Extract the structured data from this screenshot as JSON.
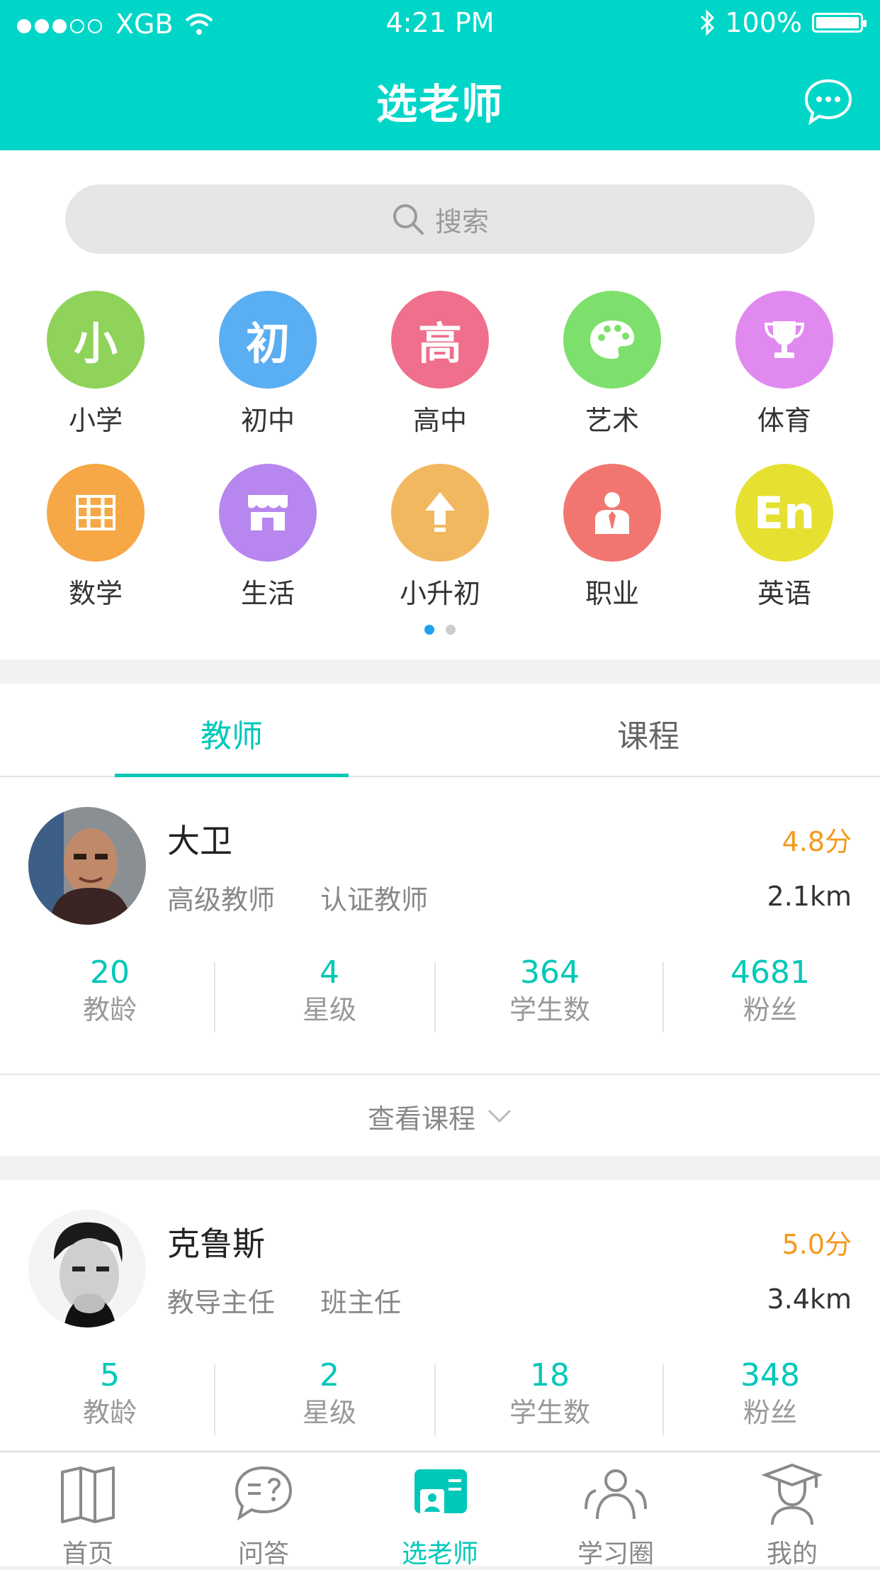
{
  "status_bar": {
    "carrier": "XGB",
    "time": "4:21 PM",
    "battery": "100%"
  },
  "header": {
    "title": "选老师"
  },
  "search": {
    "placeholder": "搜索"
  },
  "categories": [
    {
      "label": "小学",
      "glyph": "小",
      "color": "#8fd35a"
    },
    {
      "label": "初中",
      "glyph": "初",
      "color": "#5aaef2"
    },
    {
      "label": "高中",
      "glyph": "高",
      "color": "#ef6f8c"
    },
    {
      "label": "艺术",
      "glyph": "palette-icon",
      "color": "#7ee06c"
    },
    {
      "label": "体育",
      "glyph": "trophy-icon",
      "color": "#e08af0"
    },
    {
      "label": "数学",
      "glyph": "abacus-icon",
      "color": "#f5a845"
    },
    {
      "label": "生活",
      "glyph": "store-icon",
      "color": "#b886ef"
    },
    {
      "label": "小升初",
      "glyph": "arrow-up-icon",
      "color": "#f2b860"
    },
    {
      "label": "职业",
      "glyph": "person-tie-icon",
      "color": "#f27670"
    },
    {
      "label": "英语",
      "glyph": "En",
      "color": "#e6e030"
    }
  ],
  "tabs": {
    "teacher": "教师",
    "course": "课程"
  },
  "teachers": [
    {
      "name": "大卫",
      "score": "4.8分",
      "tags": [
        "高级教师",
        "认证教师"
      ],
      "distance": "2.1km",
      "stats": [
        {
          "value": "20",
          "label": "教龄"
        },
        {
          "value": "4",
          "label": "星级"
        },
        {
          "value": "364",
          "label": "学生数"
        },
        {
          "value": "4681",
          "label": "粉丝"
        }
      ],
      "more": "查看课程"
    },
    {
      "name": "克鲁斯",
      "score": "5.0分",
      "tags": [
        "教导主任",
        "班主任"
      ],
      "distance": "3.4km",
      "stats": [
        {
          "value": "5",
          "label": "教龄"
        },
        {
          "value": "2",
          "label": "星级"
        },
        {
          "value": "18",
          "label": "学生数"
        },
        {
          "value": "348",
          "label": "粉丝"
        }
      ]
    }
  ],
  "tabbar": [
    {
      "label": "首页"
    },
    {
      "label": "问答"
    },
    {
      "label": "选老师"
    },
    {
      "label": "学习圈"
    },
    {
      "label": "我的"
    }
  ],
  "colors": {
    "accent": "#00d6c8",
    "score": "#f39a1e",
    "pager_active": "#1ba3f0"
  }
}
